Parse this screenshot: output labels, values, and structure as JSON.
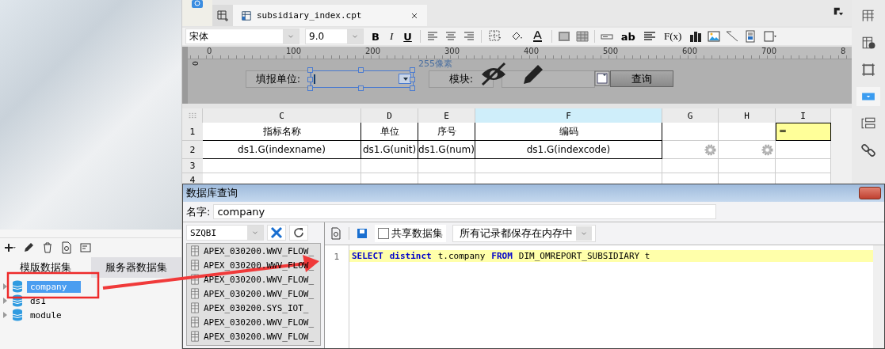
{
  "left_panel": {
    "tabs": [
      {
        "label": "模版数据集",
        "selected": true
      },
      {
        "label": "服务器数据集",
        "selected": false
      }
    ],
    "datasets": [
      {
        "name": "company",
        "selected": true
      },
      {
        "name": "ds1",
        "selected": false
      },
      {
        "name": "module",
        "selected": false
      }
    ]
  },
  "editor": {
    "tab": {
      "title": "subsidiary_index.cpt"
    },
    "format_bar": {
      "font": "宋体",
      "font_size": "9.0",
      "style_buttons": [
        "B",
        "I",
        "U"
      ],
      "text_tools": [
        "ab",
        "F(x)"
      ]
    },
    "ruler_ticks": [
      "0",
      "100",
      "200",
      "300",
      "400",
      "500",
      "600",
      "700",
      "8"
    ],
    "vertical_ruler_label": "0",
    "parameter_pane": {
      "width_hint": "255像素",
      "labels": [
        "填报单位:",
        "模块:"
      ],
      "query_button": "查询"
    },
    "sheet": {
      "columns": [
        {
          "label": "C",
          "selected": false
        },
        {
          "label": "D",
          "selected": false
        },
        {
          "label": "E",
          "selected": false
        },
        {
          "label": "F",
          "selected": true
        },
        {
          "label": "G",
          "selected": false
        },
        {
          "label": "H",
          "selected": false
        },
        {
          "label": "I",
          "selected": false
        }
      ],
      "rows": [
        {
          "number": "1",
          "cells": [
            {
              "kind": "bound",
              "text": "指标名称"
            },
            {
              "kind": "bound",
              "text": "单位"
            },
            {
              "kind": "bound",
              "text": "序号"
            },
            {
              "kind": "bound",
              "text": "编码"
            },
            {
              "kind": "plain"
            },
            {
              "kind": "plain"
            },
            {
              "kind": "formula",
              "text": "="
            }
          ]
        },
        {
          "number": "2",
          "cells": [
            {
              "kind": "bound",
              "text": "ds1.G(indexname)"
            },
            {
              "kind": "bound",
              "text": "ds1.G(unit)"
            },
            {
              "kind": "bound",
              "text": "ds1.G(num)"
            },
            {
              "kind": "bound",
              "text": "ds1.G(indexcode)"
            },
            {
              "kind": "gear"
            },
            {
              "kind": "gear"
            },
            {
              "kind": "plain"
            }
          ]
        },
        {
          "number": "3",
          "cells": [
            {
              "kind": "plain"
            },
            {
              "kind": "plain"
            },
            {
              "kind": "plain"
            },
            {
              "kind": "plain"
            },
            {
              "kind": "plain"
            },
            {
              "kind": "plain"
            },
            {
              "kind": "plain"
            }
          ]
        },
        {
          "number": "4",
          "cells": [
            {
              "kind": "plain"
            },
            {
              "kind": "plain"
            },
            {
              "kind": "plain"
            },
            {
              "kind": "plain"
            },
            {
              "kind": "plain"
            },
            {
              "kind": "plain"
            },
            {
              "kind": "plain"
            }
          ]
        }
      ]
    }
  },
  "dialog": {
    "title": "数据库查询",
    "name_label": "名字:",
    "name_value": "company",
    "connection": "SZQBI",
    "tables": [
      "APEX_030200.WWV_FLOW_",
      "APEX_030200.WWV_FLOW_",
      "APEX_030200.WWV_FLOW_",
      "APEX_030200.WWV_FLOW_",
      "APEX_030200.SYS_IOT_",
      "APEX_030200.WWV_FLOW_",
      "APEX_030200.WWV_FLOW_"
    ],
    "share_checkbox": {
      "label": "共享数据集",
      "checked": false
    },
    "storage_mode": "所有记录都保存在内存中",
    "sql_lines": [
      {
        "number": "1",
        "tokens": [
          {
            "kind": "keyword",
            "text": "SELECT"
          },
          {
            "kind": "keyword",
            "text": "distinct"
          },
          {
            "kind": "plain",
            "text": "t.company "
          },
          {
            "kind": "keyword",
            "text": "FROM"
          },
          {
            "kind": "plain",
            "text": "DIM_OMREPORT_SUBSIDIARY t"
          }
        ]
      }
    ]
  }
}
